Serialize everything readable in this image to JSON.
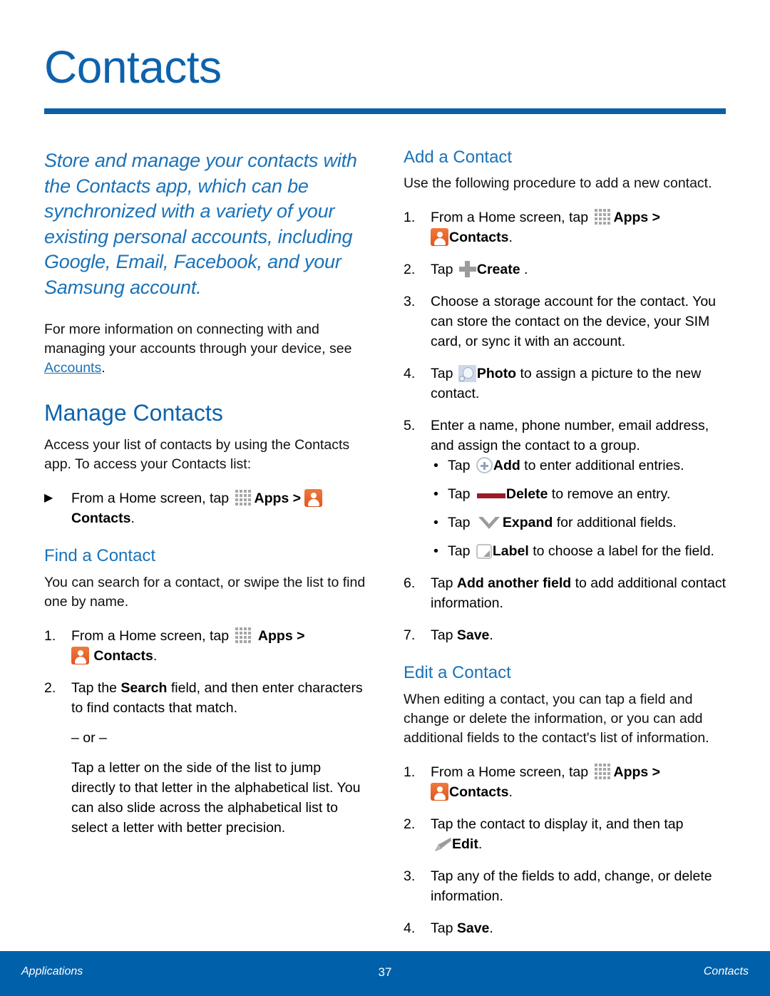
{
  "page": {
    "title": "Contacts",
    "intro": "Store and manage your contacts with the Contacts app, which can be synchronized with a variety of your existing personal accounts, including Google, Email, Facebook, and your Samsung account."
  },
  "left_column": {
    "accounts_paragraph_before": "For more information on connecting with and managing your accounts through your device, see ",
    "accounts_link": "Accounts",
    "accounts_paragraph_after": ".",
    "manage_contacts": {
      "heading": "Manage Contacts",
      "intro": "Access your list of contacts by using the Contacts app. To access your Contacts list:",
      "step_marker": "▶",
      "step_text_before": "From a Home screen, tap ",
      "apps_label": "Apps",
      "apps_separator": " > ",
      "contacts_label": "Contacts",
      "step_text_after": "."
    },
    "find_a_contact": {
      "heading": "Find a Contact",
      "intro": "You can search for a contact, or swipe the list to find one by name.",
      "step1": {
        "marker": "1.",
        "text_before": "From a Home screen, tap ",
        "apps_label": "Apps",
        "separator": " > ",
        "contacts_label": "Contacts",
        "text_after": "."
      },
      "step2": {
        "marker": "2.",
        "text_before": "Tap the ",
        "bold": "Search",
        "text_after": " field, and then enter characters to find contacts that match.",
        "or_divider": "– or –",
        "alt_text": "Tap a letter on the side of the list to jump directly to that letter in the alphabetical list. You can also slide across the alphabetical list to select a letter with better precision."
      }
    }
  },
  "right_column": {
    "add_a_contact": {
      "heading": "Add a Contact",
      "intro": "Use the following procedure to add a new contact.",
      "steps": [
        {
          "marker": "1.",
          "text_before": "From a Home screen, tap ",
          "apps_label": "Apps",
          "separator": " > ",
          "contacts_label": "Contacts",
          "text_after": "."
        },
        {
          "marker": "2.",
          "text_before": "Tap ",
          "icon_label": "Create",
          "text_after": " ."
        },
        {
          "marker": "3.",
          "text": "Choose a storage account for the contact. You can store the contact on the device, your SIM card, or sync it with an account."
        },
        {
          "marker": "4.",
          "text_before": "Tap ",
          "icon_label": "Photo",
          "text_after": "  to assign a picture to the new contact."
        },
        {
          "marker": "5.",
          "text": "Enter a name, phone number, email address, and assign the contact to a group."
        },
        {
          "marker": "6.",
          "text_before": "Tap ",
          "bold": "Add another field",
          "text_after": " to add additional contact information."
        },
        {
          "marker": "7.",
          "text_before": "Tap ",
          "bold": "Save",
          "text_after": "."
        }
      ],
      "bullets": [
        {
          "dot": "•",
          "text_before": "Tap ",
          "icon_label": "Add",
          "text_after": " to enter additional entries."
        },
        {
          "dot": "•",
          "text_before": "Tap ",
          "icon_label": "Delete",
          "text_after": "  to remove an entry."
        },
        {
          "dot": "•",
          "text_before": "Tap ",
          "icon_label": "Expand",
          "text_after": " for additional fields."
        },
        {
          "dot": "•",
          "text_before": "Tap ",
          "icon_label": "Label",
          "text_after": " to choose a label for the field."
        }
      ]
    },
    "edit_a_contact": {
      "heading": "Edit a Contact",
      "intro": "When editing a contact, you can tap a field and change or delete the information, or you can add additional fields to the contact's list of information.",
      "steps": [
        {
          "marker": "1.",
          "text_before": "From a Home screen, tap ",
          "apps_label": "Apps",
          "separator": " > ",
          "contacts_label": "Contacts",
          "text_after": "."
        },
        {
          "marker": "2.",
          "text_before": "Tap the contact to display it, and then tap ",
          "icon_label": "Edit",
          "text_after": "."
        },
        {
          "marker": "3.",
          "text": "Tap any of the fields to add, change, or delete information."
        },
        {
          "marker": "4.",
          "text_before": "Tap ",
          "bold": "Save",
          "text_after": "."
        }
      ]
    }
  },
  "footer": {
    "left": "Applications",
    "center": "37",
    "right": "Contacts"
  },
  "colors": {
    "title_blue": "#0d62ac",
    "rule_blue": "#0a5fa6",
    "heading_blue": "#1a72b8",
    "footer_blue": "#0060a9",
    "contacts_icon_orange": "#e0551f",
    "delete_icon_red": "#9b1c28",
    "icon_gray": "#9b9b9b"
  }
}
